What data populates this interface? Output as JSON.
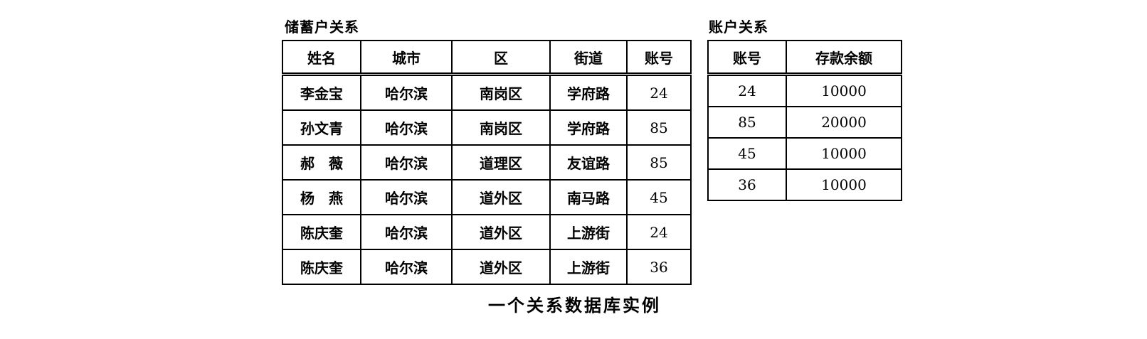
{
  "depositor": {
    "title": "储蓄户关系",
    "headers": [
      "姓名",
      "城市",
      "区",
      "街道",
      "账号"
    ],
    "rows": [
      [
        "李金宝",
        "哈尔滨",
        "南岗区",
        "学府路",
        "24"
      ],
      [
        "孙文青",
        "哈尔滨",
        "南岗区",
        "学府路",
        "85"
      ],
      [
        "郝　薇",
        "哈尔滨",
        "道理区",
        "友谊路",
        "85"
      ],
      [
        "杨　燕",
        "哈尔滨",
        "道外区",
        "南马路",
        "45"
      ],
      [
        "陈庆奎",
        "哈尔滨",
        "道外区",
        "上游街",
        "24"
      ],
      [
        "陈庆奎",
        "哈尔滨",
        "道外区",
        "上游街",
        "36"
      ]
    ]
  },
  "account": {
    "title": "账户关系",
    "headers": [
      "账号",
      "存款余额"
    ],
    "rows": [
      [
        "24",
        "10000"
      ],
      [
        "85",
        "20000"
      ],
      [
        "45",
        "10000"
      ],
      [
        "36",
        "10000"
      ]
    ]
  },
  "caption": "一个关系数据库实例"
}
